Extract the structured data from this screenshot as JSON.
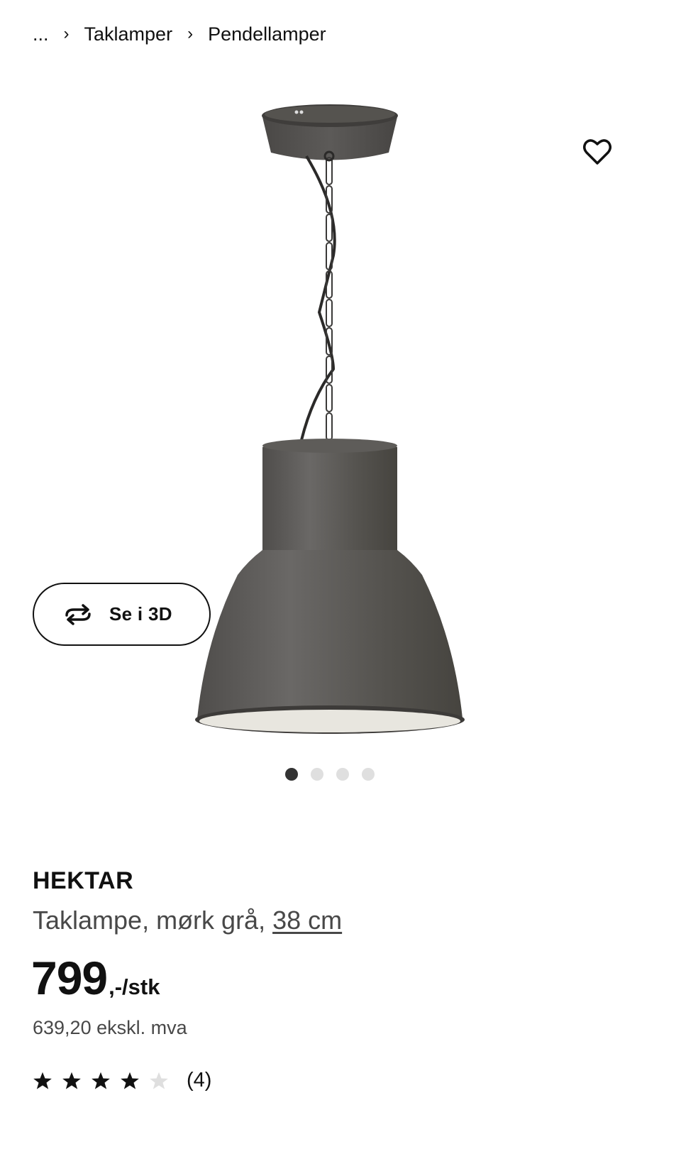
{
  "breadcrumb": {
    "ellipsis": "...",
    "items": [
      "Taklamper",
      "Pendellamper"
    ],
    "separator": "›"
  },
  "product": {
    "name": "HEKTAR",
    "description_prefix": "Taklampe, mørk grå, ",
    "size_link": "38 cm",
    "price_integer": "799",
    "price_suffix": ",-/stk",
    "price_excl_vat": "639,20 ekskl. mva",
    "rating": {
      "stars_filled": 4,
      "stars_total": 5,
      "count_label": "(4)"
    }
  },
  "media": {
    "view_3d_label": "Se i 3D",
    "carousel": {
      "total": 4,
      "active_index": 0
    }
  },
  "icons": {
    "favorite": "heart-outline-icon",
    "view_3d": "rotate-3d-icon",
    "separator": "chevron-right-icon",
    "rating": "star-icon"
  },
  "colors": {
    "text": "#111111",
    "secondary_text": "#484848",
    "lamp_shade": "#5a5856",
    "dot_active": "#333333",
    "dot_inactive": "#dfdfdf",
    "star_empty": "#dfdfdf"
  }
}
